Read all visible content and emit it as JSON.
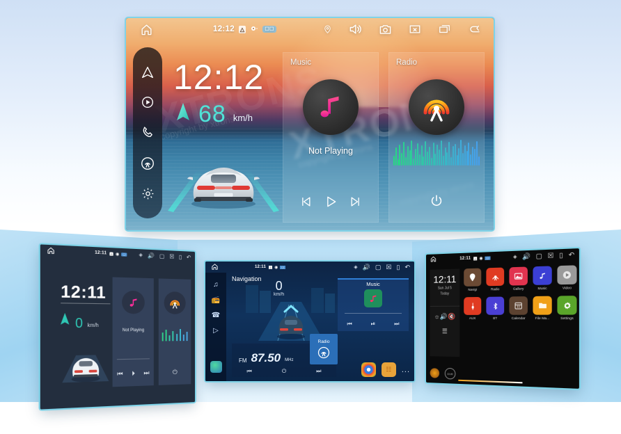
{
  "hero": {
    "status": {
      "clock": "12:12",
      "home_icon": "home-icon",
      "icons": [
        "location-pin-icon",
        "volume-icon",
        "camera-icon",
        "close-box-icon",
        "recent-apps-icon",
        "back-arrow-icon"
      ]
    },
    "dock": [
      {
        "name": "navigation-icon",
        "label": "Navigation"
      },
      {
        "name": "media-play-icon",
        "label": "Media"
      },
      {
        "name": "phone-icon",
        "label": "Phone"
      },
      {
        "name": "radio-icon",
        "label": "Radio"
      },
      {
        "name": "settings-gear-icon",
        "label": "Settings"
      }
    ],
    "clock": "12:12",
    "speed_value": "68",
    "speed_unit": "km/h",
    "music": {
      "title": "Music",
      "status": "Not Playing",
      "controls": [
        "previous-track",
        "play",
        "next-track"
      ]
    },
    "radio": {
      "title": "Radio",
      "controls": [
        "power-toggle"
      ]
    },
    "watermark_big": "XTRONS",
    "watermark_small": "copyright by xtrons"
  },
  "thumb_left": {
    "status_clock": "12:11",
    "clock": "12:11",
    "speed_value": "0",
    "speed_unit": "km/h",
    "music_status": "Not Playing"
  },
  "thumb_mid": {
    "status_clock": "12:11",
    "nav_label": "Navigation",
    "speed_value": "0",
    "speed_unit": "km/h",
    "music_title": "Music",
    "radio_badge": "Radio",
    "fm_band": "FM",
    "fm_freq": "87.50",
    "fm_unit": "MHz",
    "more_label": "..."
  },
  "thumb_right": {
    "status_clock": "12:11",
    "clock": "12:11",
    "date_line1": "Sun Jul 5",
    "date_line2": "Today",
    "apps_row1": [
      {
        "label": "Navigi",
        "icon": "map-pin-icon",
        "color": "#6b4a34"
      },
      {
        "label": "Radio",
        "icon": "radio-tower-icon",
        "color": "#e03b22"
      },
      {
        "label": "Gallery",
        "icon": "image-icon",
        "color": "#e1344f"
      },
      {
        "label": "Music",
        "icon": "music-note-icon",
        "color": "#3b3fd4"
      },
      {
        "label": "Video",
        "icon": "play-circle-icon",
        "color": "#9a9a9a"
      }
    ],
    "apps_row2": [
      {
        "label": "AUX",
        "icon": "aux-plug-icon",
        "color": "#e03b22"
      },
      {
        "label": "BT",
        "icon": "bluetooth-icon",
        "color": "#4a3fd4"
      },
      {
        "label": "Calendar",
        "icon": "calendar-icon",
        "color": "#5c4230"
      },
      {
        "label": "File Ma...",
        "icon": "folder-icon",
        "color": "#f0a018"
      },
      {
        "label": "Settings",
        "icon": "gear-icon",
        "color": "#5aa52a"
      }
    ]
  },
  "colors": {
    "accent_cyan": "#4fe3d8",
    "music_pink": "#ff2d9b",
    "radio_orange": "#ff8a1e",
    "bezel": "#7fd3e8"
  }
}
